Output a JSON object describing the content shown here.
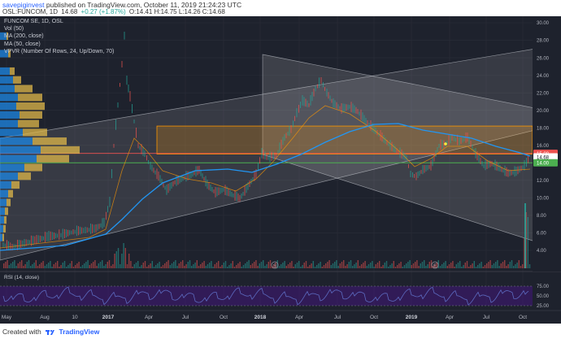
{
  "header": {
    "username": "savepiginvest",
    "published": "published on TradingView.com, October 11, 2019 21:24:23 UTC",
    "symbol": "OSL:FUNCOM, 1D",
    "last": "14.68",
    "change": "+0.27 (+1.87%)",
    "ohlc": "O:14.41 H:14.75 L:14.26 C:14.68"
  },
  "legend": {
    "title": "FUNCOM SE, 1D, OSL",
    "vol": "Vol (50)",
    "ma200": "MA (200, close)",
    "ma50": "MA (50, close)",
    "vpvr": "VPVR (Number Of Rows, 24, Up/Down, 70)",
    "rsi": "RSI (14, close)"
  },
  "price_axis": {
    "ticks": [
      "30.00",
      "28.00",
      "26.00",
      "24.00",
      "22.00",
      "20.00",
      "18.00",
      "16.00",
      "14.00",
      "12.00",
      "10.00",
      "8.00",
      "6.00",
      "4.00"
    ],
    "badges": [
      {
        "label": "15.08",
        "value": 15.08,
        "color": "#ef5350"
      },
      {
        "label": "14.68",
        "value": 14.68,
        "color": "#ffffff"
      },
      {
        "label": "14.00",
        "value": 14.0,
        "color": "#4caf50"
      }
    ]
  },
  "rsi_axis": {
    "ticks": [
      "75.00",
      "50.00",
      "25.00"
    ]
  },
  "time_axis": {
    "labels": [
      "May",
      "Aug",
      "10",
      "2017",
      "Apr",
      "Jul",
      "Oct",
      "2018",
      "Apr",
      "Jul",
      "Oct",
      "2019",
      "Apr",
      "Jul",
      "Oct"
    ]
  },
  "markers": [
    "S",
    "E"
  ],
  "colors": {
    "background": "#1e222d",
    "ma_blue": "#2196f3",
    "ma_orange": "#ff9800",
    "channel_fill": "#e0e0e0",
    "zone_fill": "#ff9800",
    "rsi_line": "#5c6bc0",
    "rsi_band": "#4a148c"
  },
  "footer": {
    "created_with": "Created with",
    "brand": "TradingView"
  }
}
